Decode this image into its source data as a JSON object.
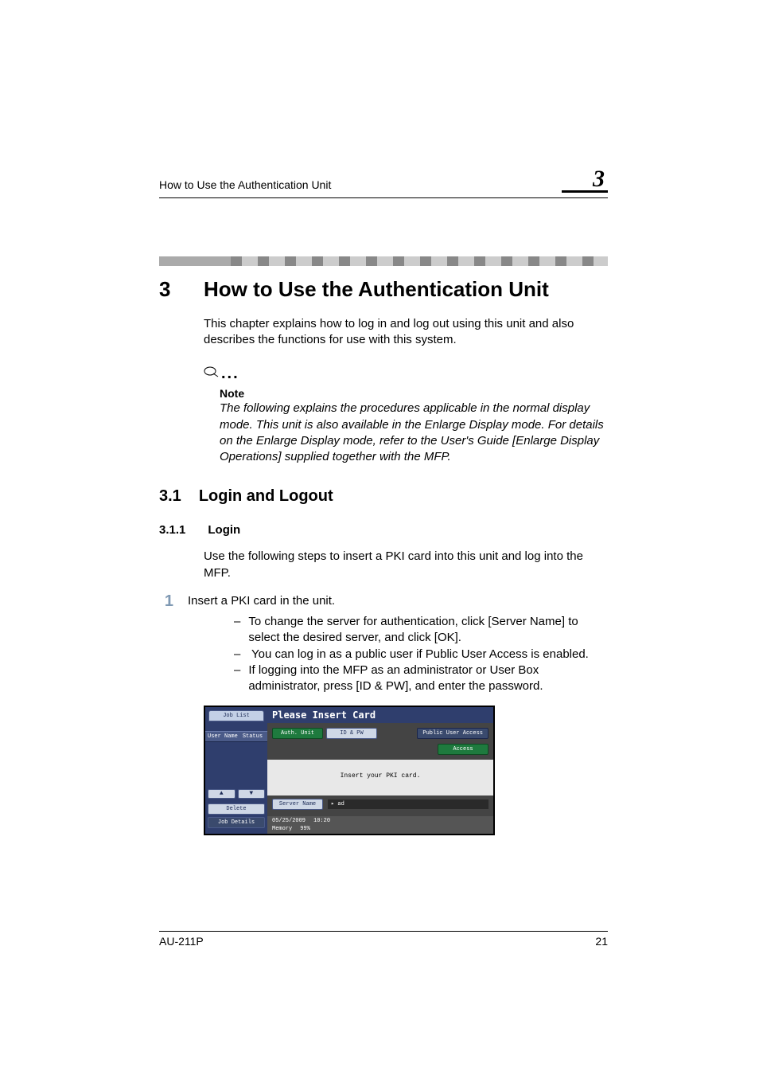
{
  "header": {
    "running_title": "How to Use the Authentication Unit",
    "chapter_tab": "3"
  },
  "title": {
    "num": "3",
    "text": "How to Use the Authentication Unit"
  },
  "intro": "This chapter explains how to log in and log out using this unit and also describes the functions for use with this system.",
  "note": {
    "label": "Note",
    "text": "The following explains the procedures applicable in the normal display mode. This unit is also available in the Enlarge Display mode. For details on the Enlarge Display mode, refer to the User's Guide [Enlarge Display Operations] supplied together with the MFP."
  },
  "section": {
    "num": "3.1",
    "title": "Login and Logout"
  },
  "subsection": {
    "num": "3.1.1",
    "title": "Login",
    "intro": "Use the following steps to insert a PKI card into this unit and log into the MFP."
  },
  "step1": {
    "num": "1",
    "text": "Insert a PKI card in the unit.",
    "bullets": [
      "To change the server for authentication, click [Server Name] to select the desired server, and click [OK].",
      "You can log in as a public user if Public User Access is enabled.",
      "If logging into the MFP as an administrator or User Box administrator, press [ID & PW], and enter the password."
    ]
  },
  "screenshot": {
    "left_tab": "Job List",
    "title": "Please Insert Card",
    "auth_unit": "Auth. Unit",
    "id_pw": "ID & PW",
    "public_user": "Public User Access",
    "access": "Access",
    "left_col1": "User Name",
    "left_col2": "Status",
    "msg": "Insert your PKI card.",
    "delete": "Delete",
    "job_details": "Job Details",
    "server_name": "Server Name",
    "server_value": "ad",
    "date": "05/25/2009",
    "time": "10:20",
    "memory": "Memory",
    "memory_pct": "99%"
  },
  "footer": {
    "model": "AU-211P",
    "page": "21"
  }
}
